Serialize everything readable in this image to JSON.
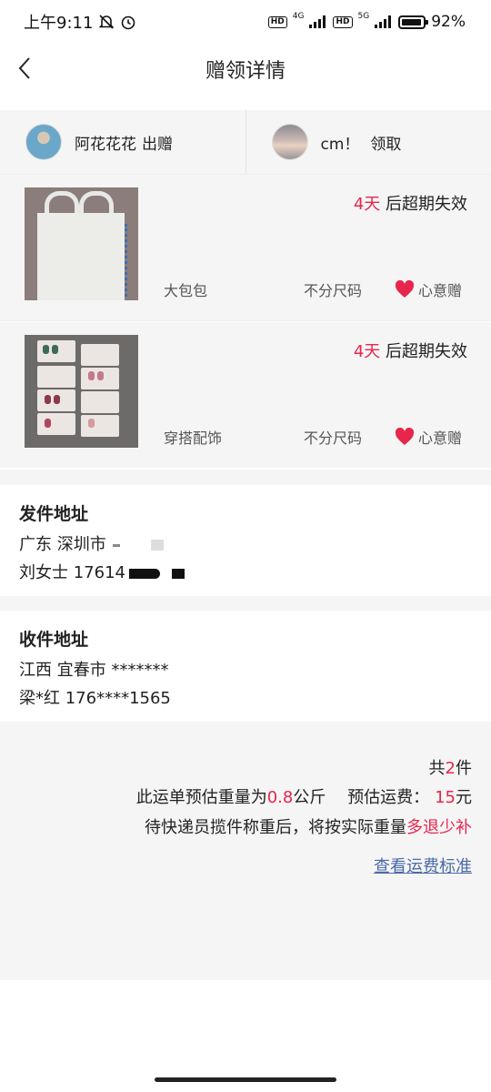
{
  "status": {
    "time": "上午9:11",
    "net1": "4G",
    "net2": "5G",
    "battery": "92%"
  },
  "header": {
    "title": "赠领详情"
  },
  "parties": {
    "giver": {
      "name": "阿花花花",
      "action": "出赠"
    },
    "receiver": {
      "name": "cm！",
      "action": "领取"
    }
  },
  "items": [
    {
      "days": "4天",
      "expire_suffix": "后超期失效",
      "category": "大包包",
      "size": "不分尺码",
      "wish": "心意赠"
    },
    {
      "days": "4天",
      "expire_suffix": "后超期失效",
      "category": "穿搭配饰",
      "size": "不分尺码",
      "wish": "心意赠"
    }
  ],
  "sender_address": {
    "heading": "发件地址",
    "line1": "广东 深圳市",
    "line2": "刘女士 17614"
  },
  "receiver_address": {
    "heading": "收件地址",
    "line1": "江西 宜春市 *******",
    "line2": "梁*红 176****1565"
  },
  "summary": {
    "count_prefix": "共",
    "count": "2",
    "count_suffix": "件",
    "weight_prefix": "此运单预估重量为",
    "weight": "0.8",
    "weight_unit": "公斤",
    "fee_prefix": "预估运费：",
    "fee": "15",
    "fee_unit": "元",
    "note_prefix": "待快递员揽件称重后，将按实际重量",
    "note_highlight": "多退少补",
    "link": "查看运费标准"
  },
  "colors": {
    "accent": "#e8264d",
    "link": "#4a6aa8",
    "section_bg": "#f5f5f5"
  }
}
